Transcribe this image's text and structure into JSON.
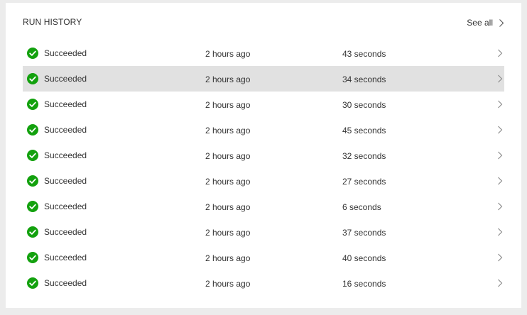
{
  "panel": {
    "title": "RUN HISTORY",
    "see_all_label": "See all"
  },
  "colors": {
    "success": "#13a10e",
    "selected_row": "#e1e1e1",
    "chevron": "#8a8a8a"
  },
  "icons": {
    "status": "check-circle-icon",
    "row_nav": "chevron-right-icon",
    "see_all_nav": "chevron-right-icon"
  },
  "runs": [
    {
      "status": "Succeeded",
      "time": "2 hours ago",
      "duration": "43 seconds",
      "selected": false
    },
    {
      "status": "Succeeded",
      "time": "2 hours ago",
      "duration": "34 seconds",
      "selected": true
    },
    {
      "status": "Succeeded",
      "time": "2 hours ago",
      "duration": "30 seconds",
      "selected": false
    },
    {
      "status": "Succeeded",
      "time": "2 hours ago",
      "duration": "45 seconds",
      "selected": false
    },
    {
      "status": "Succeeded",
      "time": "2 hours ago",
      "duration": "32 seconds",
      "selected": false
    },
    {
      "status": "Succeeded",
      "time": "2 hours ago",
      "duration": "27 seconds",
      "selected": false
    },
    {
      "status": "Succeeded",
      "time": "2 hours ago",
      "duration": "6 seconds",
      "selected": false
    },
    {
      "status": "Succeeded",
      "time": "2 hours ago",
      "duration": "37 seconds",
      "selected": false
    },
    {
      "status": "Succeeded",
      "time": "2 hours ago",
      "duration": "40 seconds",
      "selected": false
    },
    {
      "status": "Succeeded",
      "time": "2 hours ago",
      "duration": "16 seconds",
      "selected": false
    }
  ]
}
